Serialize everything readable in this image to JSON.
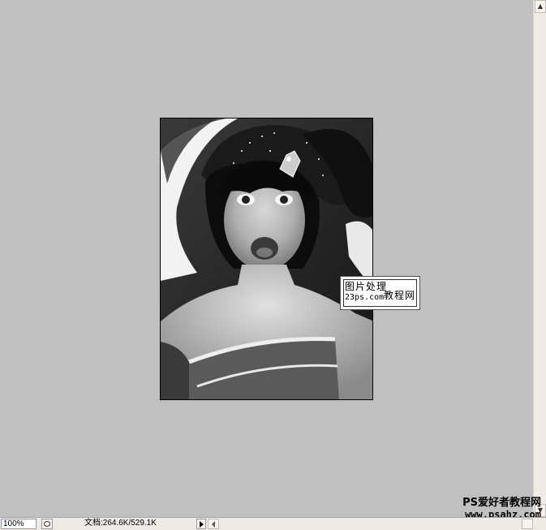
{
  "status_bar": {
    "zoom": "100%",
    "doc_info": "文档:264.6K/529.1K"
  },
  "image": {
    "subject": "black-and-white portrait photo",
    "watermark_line1": "图片处理",
    "watermark_line2a": "23ps.com",
    "watermark_line2b": "教程网"
  },
  "site_watermark": {
    "line1": "PS爱好者教程网",
    "line2": "www.psahz.com"
  },
  "icons": {
    "status_icon": "status-circle-icon",
    "play_arrow": "play-arrow-icon",
    "scroll_up": "scroll-up-arrow-icon",
    "scroll_down": "scroll-down-arrow-icon",
    "scroll_left": "scroll-left-arrow-icon",
    "scroll_right": "scroll-right-arrow-icon"
  },
  "colors": {
    "canvas_bg": "#c0c0c0",
    "chrome_bg": "#ecebe6"
  }
}
